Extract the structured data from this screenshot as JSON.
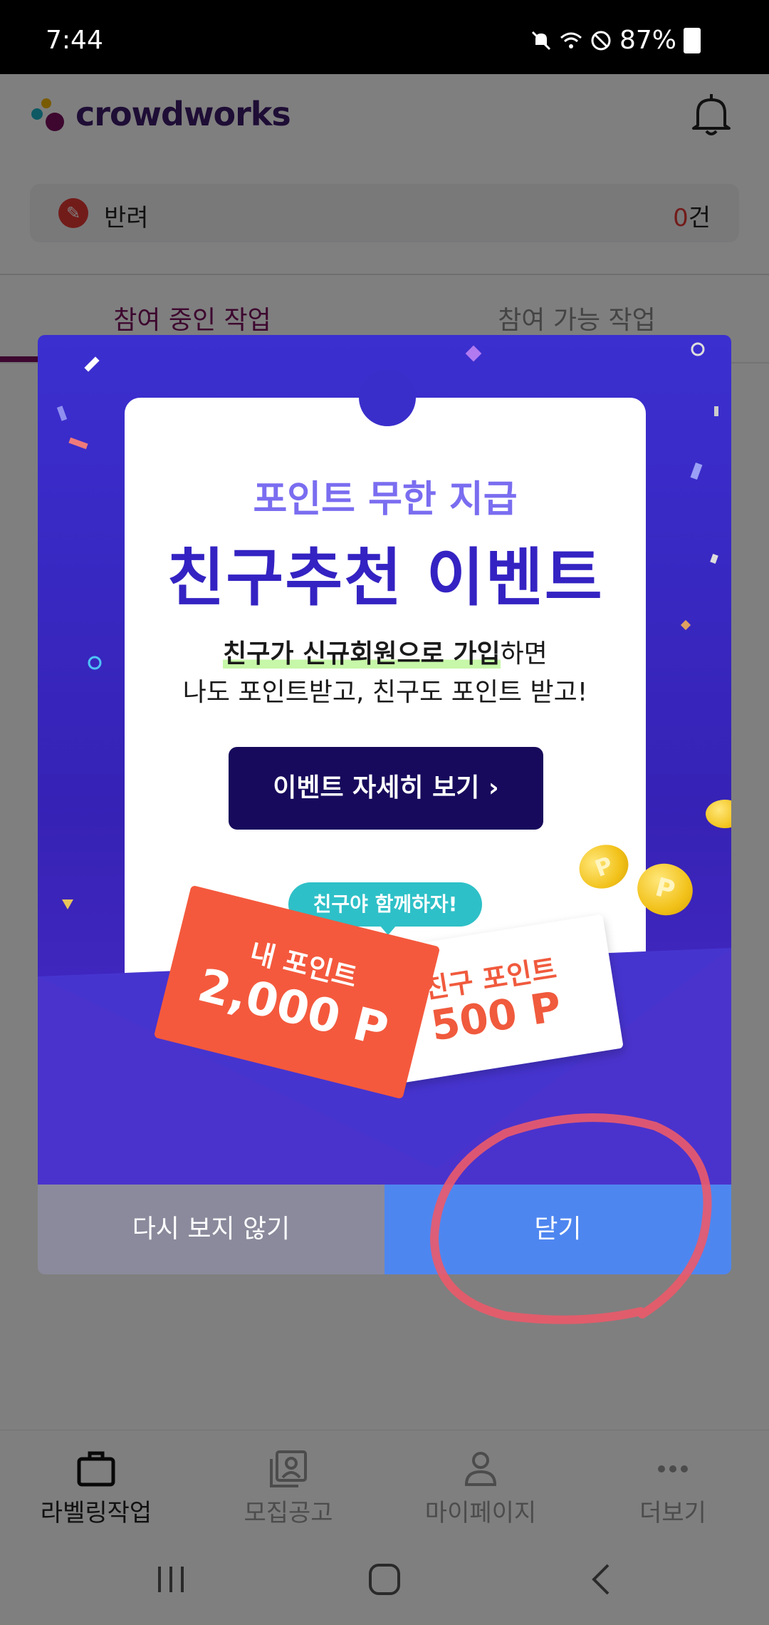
{
  "status_bar": {
    "time": "7:44",
    "battery": "87%"
  },
  "header": {
    "app_name": "crowdworks"
  },
  "reject": {
    "label": "반려",
    "count_num": "0",
    "count_unit": "건"
  },
  "tabs": {
    "active": "참여 중인 작업",
    "inactive": "참여 가능 작업"
  },
  "modal": {
    "subtitle": "포인트 무한 지급",
    "title": "친구추천 이벤트",
    "desc_highlight": "친구가 신규회원으로 가입",
    "desc_tail": "하면",
    "desc_line2": "나도 포인트받고, 친구도 포인트 받고!",
    "event_button": "이벤트 자세히 보기",
    "event_button_arrow": "›",
    "bubble": "친구야 함께하자!",
    "my_point_label": "내 포인트",
    "my_point_value": "2,000 P",
    "friend_point_label": "친구 포인트",
    "friend_point_value": "500 P",
    "coin_letter": "P",
    "never_show": "다시 보지 않기",
    "close": "닫기"
  },
  "bottom_nav": {
    "items": [
      {
        "label": "라벨링작업",
        "icon": "briefcase-icon"
      },
      {
        "label": "모집공고",
        "icon": "portrait-gallery-icon"
      },
      {
        "label": "마이페이지",
        "icon": "person-icon"
      },
      {
        "label": "더보기",
        "icon": "more-dots-icon"
      }
    ]
  },
  "colors": {
    "brand": "#7b0e5f",
    "banner": "#3b2fd0",
    "close_button": "#4e86f0",
    "never_button": "#8a8a9c"
  }
}
